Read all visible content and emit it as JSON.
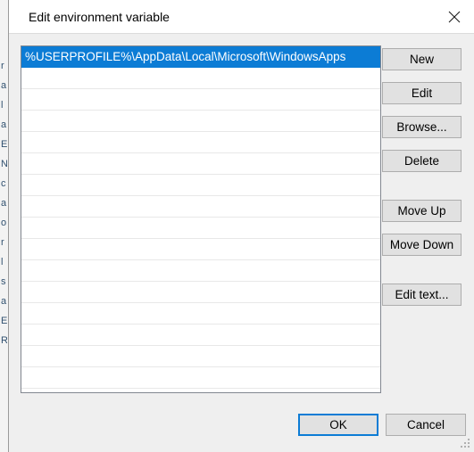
{
  "window": {
    "title": "Edit environment variable",
    "close_icon": "close-icon",
    "accent_color": "#0c7cd5",
    "background_color": "#efefef",
    "titlebar_color": "#ffffff"
  },
  "list": {
    "selected_index": 0,
    "row_count": 16,
    "selection_color": "#0c7cd5",
    "rows": [
      "%USERPROFILE%\\AppData\\Local\\Microsoft\\WindowsApps",
      "",
      "",
      "",
      "",
      "",
      "",
      "",
      "",
      "",
      "",
      "",
      "",
      "",
      "",
      ""
    ]
  },
  "side_buttons": {
    "new": "New",
    "edit": "Edit",
    "browse": "Browse...",
    "delete": "Delete",
    "move_up": "Move Up",
    "move_down": "Move Down",
    "edit_text": "Edit text..."
  },
  "footer": {
    "ok": "OK",
    "cancel": "Cancel"
  },
  "background_window": {
    "fragments": [
      "r",
      "a",
      "l",
      "a",
      "E",
      "N",
      "c",
      "a",
      "o",
      "r",
      "l",
      "s",
      "a",
      "E",
      "R"
    ]
  }
}
